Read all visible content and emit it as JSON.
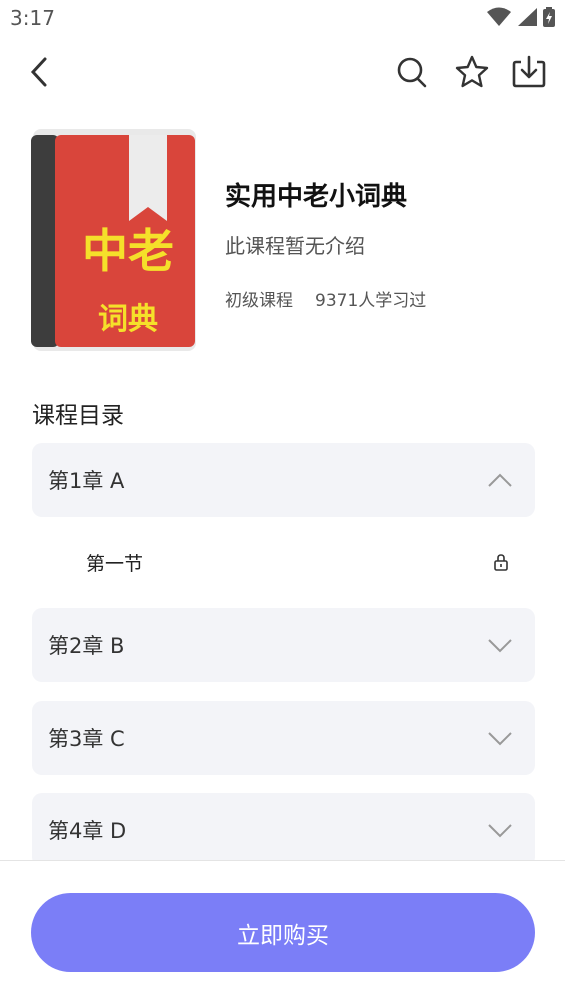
{
  "status_bar": {
    "time": "3:17"
  },
  "nav": {
    "back_icon": "chevron-left-icon",
    "search_icon": "search-icon",
    "favorite_icon": "star-icon",
    "download_icon": "download-icon"
  },
  "course": {
    "cover_text_top": "中老",
    "cover_text_bottom": "词典",
    "title": "实用中老小词典",
    "description": "此课程暂无介绍",
    "level": "初级课程",
    "learners": "9371人学习过"
  },
  "catalog": {
    "title": "课程目录",
    "chapters": [
      {
        "label": "第1章 A",
        "expanded": true
      },
      {
        "label": "第2章 B",
        "expanded": false
      },
      {
        "label": "第3章 C",
        "expanded": false
      },
      {
        "label": "第4章 D",
        "expanded": false
      }
    ],
    "lessons": [
      {
        "label": "第一节",
        "locked": true
      }
    ]
  },
  "footer": {
    "buy_label": "立即购买"
  },
  "colors": {
    "accent": "#7b7ef7",
    "chapter_bg": "#f3f4f8",
    "cover_red": "#d9453b",
    "cover_yellow": "#f5e02a"
  }
}
